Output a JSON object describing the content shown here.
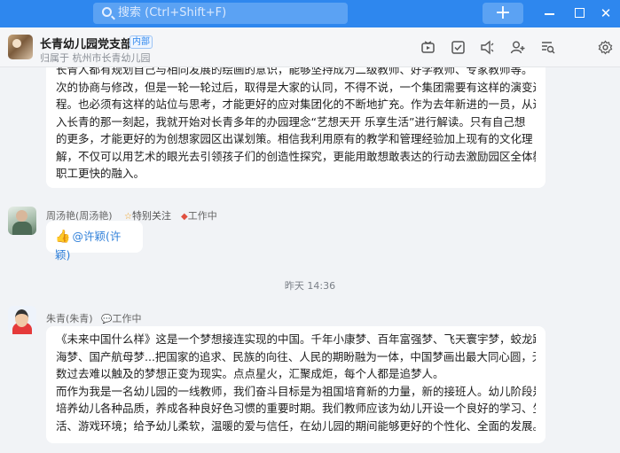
{
  "titlebar": {
    "search_placeholder": "搜索 (Ctrl+Shift+F)",
    "add_label": "+",
    "close_label": "✕"
  },
  "header": {
    "group_name": "长青幼儿园党支部",
    "badge": "内部",
    "subtitle": "归属于 杭州市长青幼儿园"
  },
  "messages": [
    {
      "lines": [
        "长青人都有规划自己与相同发展的绘画的意识，能够坚持成为二级教师、好学教师、专家教师等。",
        "次的协商与修改，但是一轮一轮过后，取得是大家的认同，不得不说，一个集团需要有这样的演变过",
        "程。也必须有这样的站位与思考，才能更好的应对集团化的不断地扩充。作为去年新进的一员，从进",
        "入长青的那一刻起，我就开始对长青多年的办园理念“艺想天开 乐享生活”进行解读。只有自己想",
        "的更多，才能更好的为创想家园区出谋划策。相信我利用原有的教学和管理经验加上现有的文化理",
        "解，不仅可以用艺术的眼光去引领孩子们的创造性探究，更能用敢想敢表达的行动去激励园区全体教",
        "职工更快的融入。"
      ]
    },
    {
      "sender": "周汤艳(周汤艳)",
      "special_tag": "特别关注",
      "status": "工作中",
      "mention": "@许颖(许颖)"
    },
    {
      "time": "昨天 14:36"
    },
    {
      "sender": "朱青(朱青)",
      "status": "工作中",
      "lines": [
        "《未来中国什么样》这是一个梦想接连实现的中国。千年小康梦、百年富强梦、飞天寰宇梦，蛟龙蹈",
        "海梦、国产航母梦...把国家的追求、民族的向往、人民的期盼融为一体，中国梦画出最大同心圆，无",
        "数过去难以触及的梦想正变为现实。点点星火，汇聚成炬，每个人都是追梦人。",
        "而作为我是一名幼儿园的一线教师，我们奋斗目标是为祖国培育新的力量，新的接班人。幼儿阶段是",
        "培养幼儿各种品质，养成各种良好色习惯的重要时期。我们教师应该为幼儿开设一个良好的学习、生",
        "活、游戏环境；给予幼儿柔软，温暖的爱与信任，在幼儿园的期间能够更好的个性化、全面的发展。"
      ]
    }
  ]
}
